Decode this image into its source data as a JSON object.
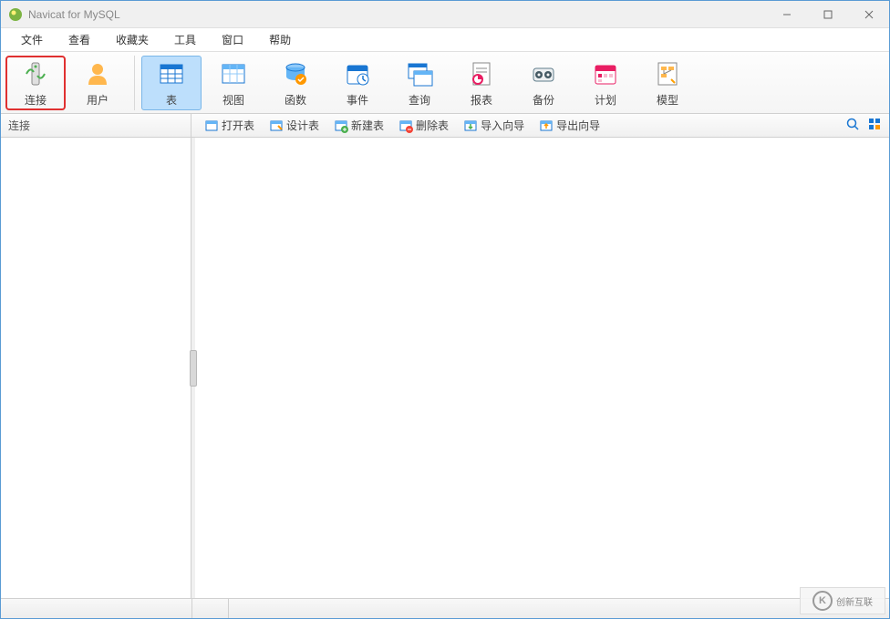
{
  "titlebar": {
    "title": "Navicat for MySQL"
  },
  "menubar": {
    "items": [
      {
        "label": "文件"
      },
      {
        "label": "查看"
      },
      {
        "label": "收藏夹"
      },
      {
        "label": "工具"
      },
      {
        "label": "窗口"
      },
      {
        "label": "帮助"
      }
    ]
  },
  "toolbar": {
    "groups": [
      [
        {
          "label": "连接",
          "icon": "connection-icon",
          "highlighted": true
        },
        {
          "label": "用户",
          "icon": "user-icon"
        }
      ],
      [
        {
          "label": "表",
          "icon": "table-icon",
          "active": true
        },
        {
          "label": "视图",
          "icon": "view-icon"
        },
        {
          "label": "函数",
          "icon": "function-icon"
        },
        {
          "label": "事件",
          "icon": "event-icon"
        },
        {
          "label": "查询",
          "icon": "query-icon"
        },
        {
          "label": "报表",
          "icon": "report-icon"
        },
        {
          "label": "备份",
          "icon": "backup-icon"
        },
        {
          "label": "计划",
          "icon": "schedule-icon"
        },
        {
          "label": "模型",
          "icon": "model-icon"
        }
      ]
    ]
  },
  "subtoolbar": {
    "left_label": "连接",
    "buttons": [
      {
        "label": "打开表",
        "icon": "open-table-icon"
      },
      {
        "label": "设计表",
        "icon": "design-table-icon"
      },
      {
        "label": "新建表",
        "icon": "new-table-icon"
      },
      {
        "label": "删除表",
        "icon": "delete-table-icon"
      },
      {
        "label": "导入向导",
        "icon": "import-wizard-icon"
      },
      {
        "label": "导出向导",
        "icon": "export-wizard-icon"
      }
    ]
  },
  "watermark": {
    "text": "创新互联"
  }
}
